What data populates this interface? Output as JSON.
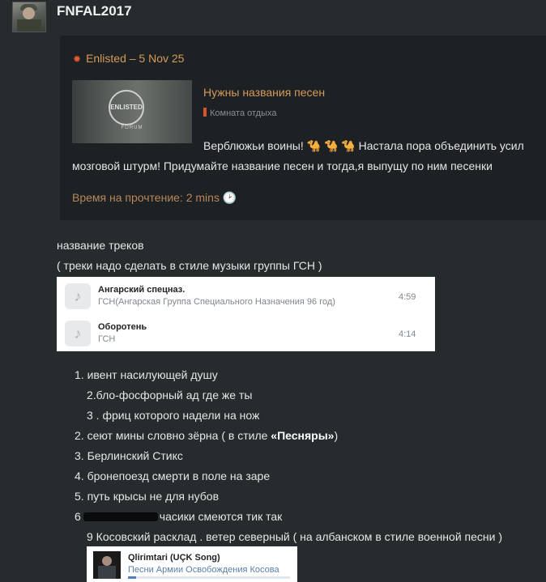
{
  "post": {
    "username": "FNFAL2017"
  },
  "quote": {
    "header": "Enlisted – 5 Nov 25",
    "thumb_emblem": "ENLISTED",
    "thumb_caption": "FORUM",
    "title": "Нужны названия песен",
    "category": "Комната отдыха",
    "text_line1": "Верблюжьи воины! 🐪 🐪 🐪  Настала пора объединить усил",
    "text_line2": "мозговой штурм! Придумайте название песен и тогда,я выпущу по ним песенки",
    "reading_time": "Время на прочтение: 2 mins 🕑"
  },
  "body": {
    "line1": "название треков",
    "line2": "( треки надо сделать в стиле музыки группы ГСН )"
  },
  "tracks": [
    {
      "title": "Ангарский спецназ.",
      "artist": "ГСН(Ангарская Группа Специального Назначения 96 год)",
      "duration": "4:59"
    },
    {
      "title": "Оборотень",
      "artist": "ГСН",
      "duration": "4:14"
    }
  ],
  "list": {
    "i1": "1. ивент насилующей душу",
    "i1a": "2.бло-фосфорный ад где же ты",
    "i1b": "3 . фриц которого надели на нож",
    "i2_pre": "2. сеют мины словно зёрна ( в стиле ",
    "i2_bold": "«Песняры»",
    "i2_post": ")",
    "i3": "3. Берлинский Стикс",
    "i4": "4. бронепоезд смерти в поле на заре",
    "i5": "5. путь крысы не для нубов",
    "i6_pre": "6",
    "i6_post": "часики смеются тик так",
    "i9": "9 Косовский расклад . ветер северный ( на албанском в стиле военной песни )"
  },
  "song": {
    "title": "Qlirimtari (UÇK Song)",
    "artist": "Песни Армии Освобождения Косова",
    "progress": 0.05
  },
  "colors": {
    "accent": "#d69a5a",
    "category_bar": "#d9542c",
    "progress": "#5181b8"
  }
}
